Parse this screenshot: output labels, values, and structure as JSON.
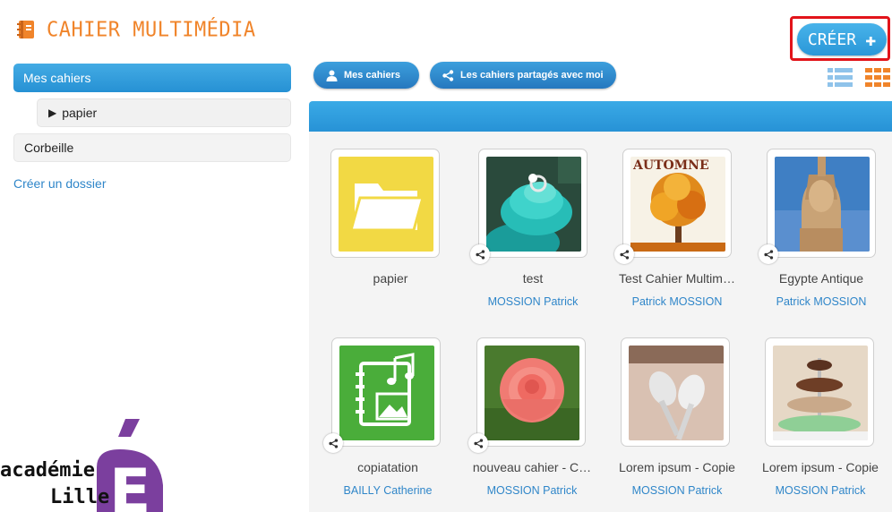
{
  "app": {
    "title": "CAHIER MULTIMÉDIA"
  },
  "toolbar": {
    "create_label": "CRÉER",
    "create_icon": "plus-icon"
  },
  "sidebar": {
    "items": [
      {
        "label": "Mes cahiers"
      },
      {
        "label": "papier"
      },
      {
        "label": "Corbeille"
      }
    ],
    "create_folder_label": "Créer un dossier"
  },
  "tabs": {
    "mine_label": "Mes cahiers",
    "shared_label": "Les cahiers partagés avec moi"
  },
  "logo": {
    "line1": "académie",
    "line2": "Lille"
  },
  "notebooks": [
    {
      "title": "papier",
      "owner": "",
      "thumb": "folder-icon",
      "shared": false
    },
    {
      "title": "test",
      "owner": "MOSSION Patrick",
      "thumb": "cupcake-photo",
      "shared": true
    },
    {
      "title": "Test Cahier Multim…",
      "owner": "Patrick MOSSION",
      "thumb": "autumn-tree-photo",
      "thumb_text": "AUTOMNE",
      "shared": true
    },
    {
      "title": "Egypte Antique",
      "owner": "Patrick MOSSION",
      "thumb": "egyptian-statue-photo",
      "shared": true
    },
    {
      "title": "copiatation",
      "owner": "BAILLY Catherine",
      "thumb": "multimedia-notebook-icon",
      "shared": true
    },
    {
      "title": "nouveau cahier - C…",
      "owner": "MOSSION Patrick",
      "thumb": "rose-photo",
      "shared": true
    },
    {
      "title": "Lorem ipsum - Copie",
      "owner": "MOSSION Patrick",
      "thumb": "spoons-photo",
      "shared": false
    },
    {
      "title": "Lorem ipsum - Copie",
      "owner": "MOSSION Patrick",
      "thumb": "cupcake-tower-photo",
      "shared": false
    }
  ],
  "colors": {
    "accent": "#2a97d8",
    "brand_orange": "#f0842a",
    "highlight_border": "#e2141a",
    "link": "#2f86c9"
  }
}
